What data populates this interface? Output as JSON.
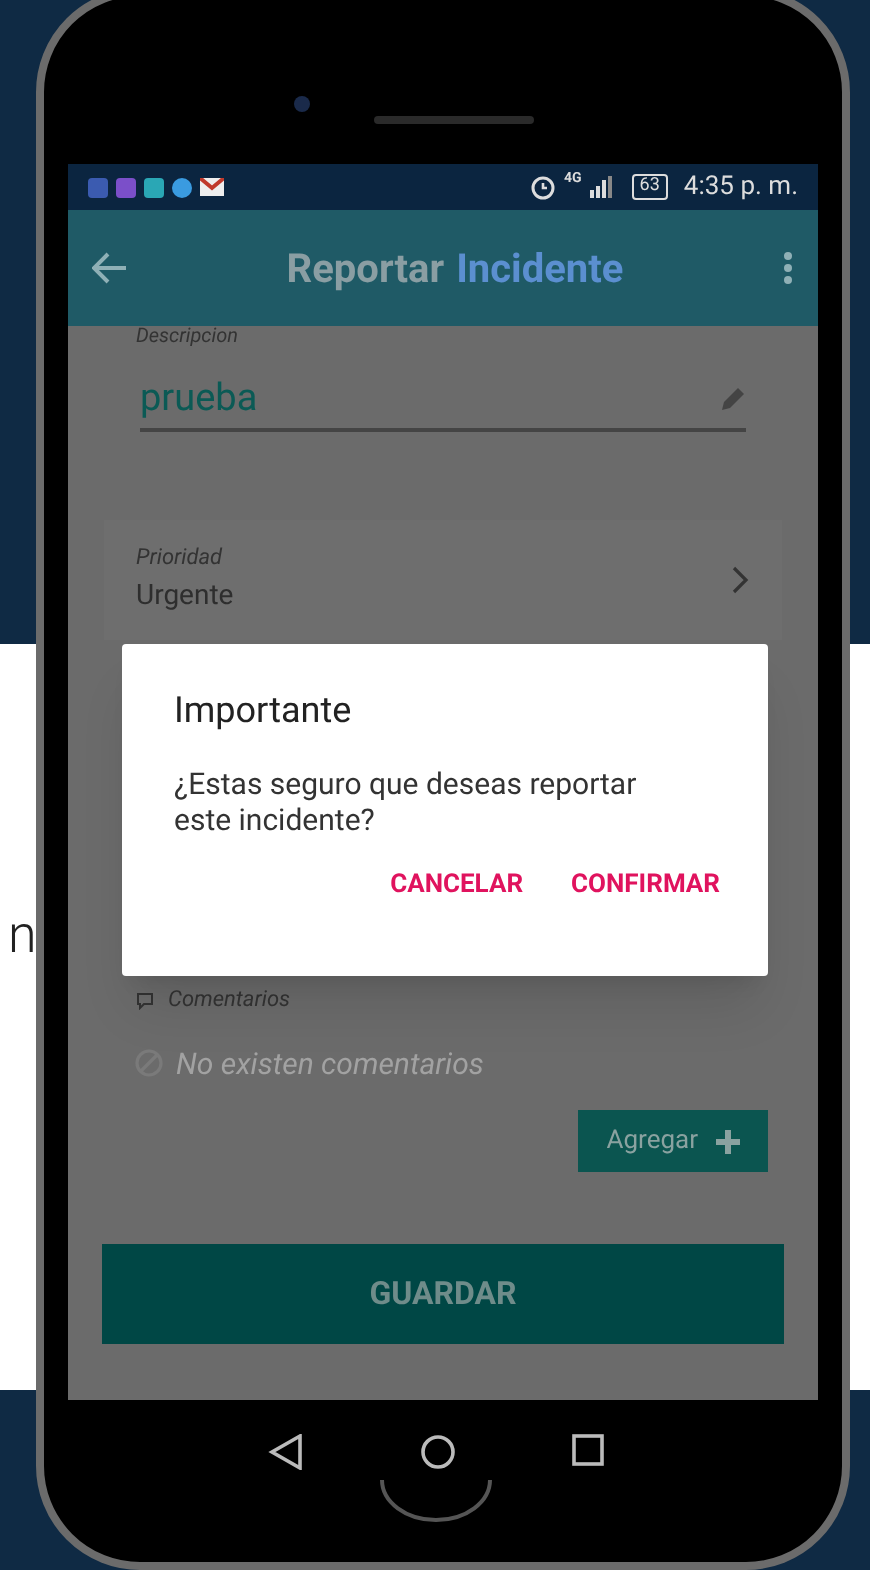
{
  "status_bar": {
    "network": "4G",
    "battery": "63",
    "time": "4:35 p. m."
  },
  "app_bar": {
    "title_parts": [
      "Reportar",
      "Incidente"
    ]
  },
  "form": {
    "description": {
      "label": "Descripcion",
      "value": "prueba"
    },
    "priority": {
      "label": "Prioridad",
      "value": "Urgente"
    },
    "comments": {
      "label": "Comentarios",
      "empty_text": "No existen comentarios",
      "add_button": "Agregar"
    },
    "save_button": "GUARDAR"
  },
  "dialog": {
    "title": "Importante",
    "message": "¿Estas seguro que deseas reportar este incidente?",
    "buttons": [
      "CANCELAR",
      "CONFIRMAR"
    ]
  },
  "callout": {
    "text_fragment": "n"
  }
}
